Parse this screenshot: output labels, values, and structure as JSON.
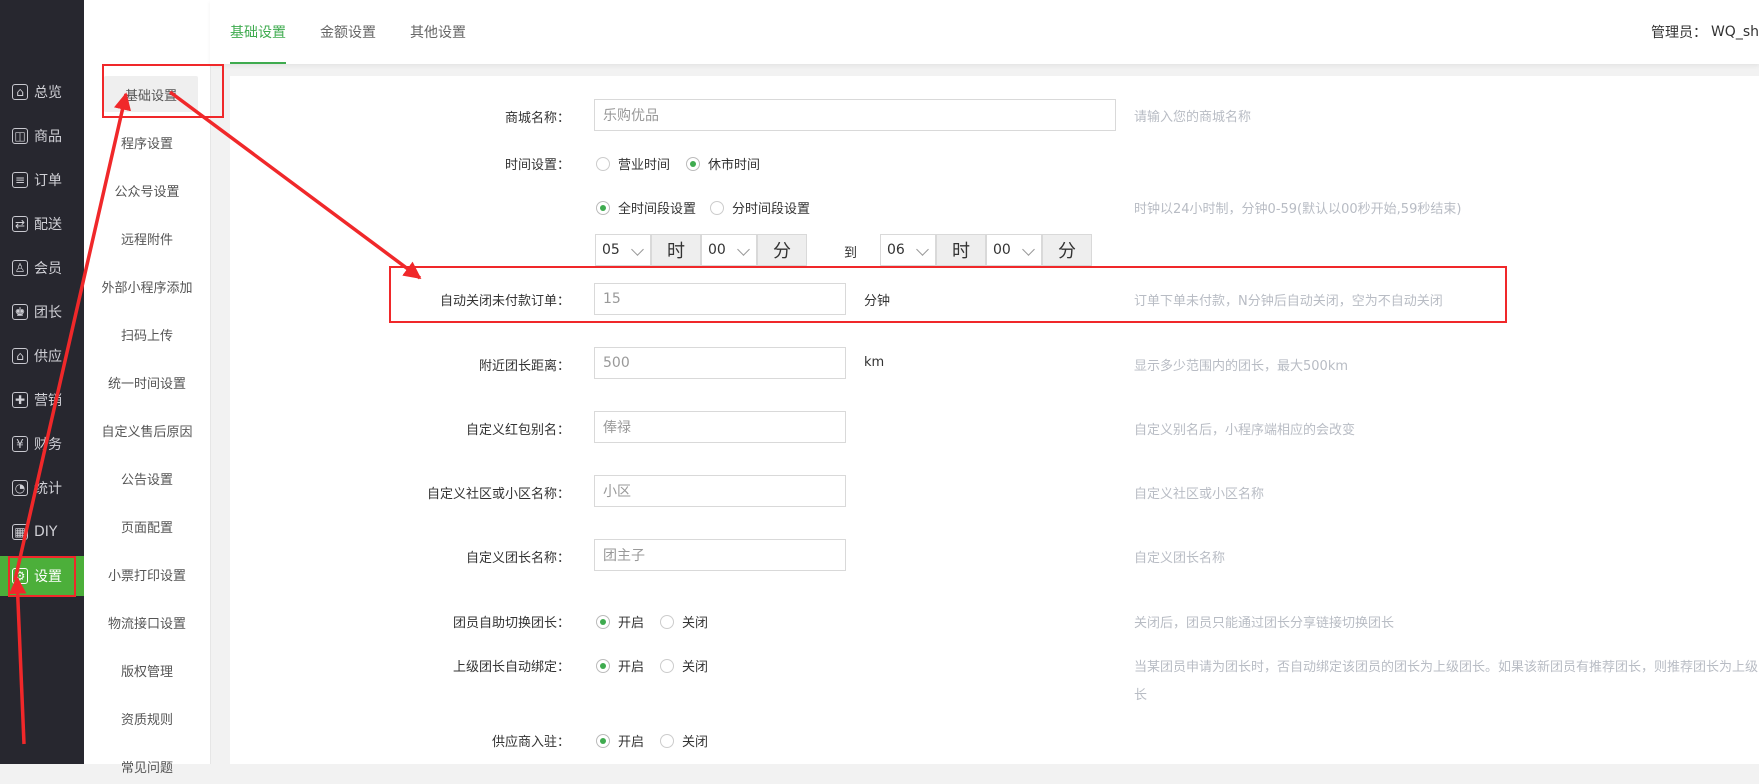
{
  "leftbar": {
    "items": [
      {
        "label": "总览",
        "icon": "home-icon",
        "glyph": "⌂"
      },
      {
        "label": "商品",
        "icon": "goods-icon",
        "glyph": "◫"
      },
      {
        "label": "订单",
        "icon": "order-icon",
        "glyph": "≡"
      },
      {
        "label": "配送",
        "icon": "delivery-icon",
        "glyph": "⇄"
      },
      {
        "label": "会员",
        "icon": "member-icon",
        "glyph": "♙"
      },
      {
        "label": "团长",
        "icon": "leader-icon",
        "glyph": "♚"
      },
      {
        "label": "供应",
        "icon": "supply-icon",
        "glyph": "⌂"
      },
      {
        "label": "营销",
        "icon": "gift-icon",
        "glyph": "✚"
      },
      {
        "label": "财务",
        "icon": "finance-icon",
        "glyph": "¥"
      },
      {
        "label": "统计",
        "icon": "stats-icon",
        "glyph": "◔"
      },
      {
        "label": "DIY",
        "icon": "diy-icon",
        "glyph": "▦"
      },
      {
        "label": "设置",
        "icon": "settings-icon",
        "glyph": "⚙"
      }
    ]
  },
  "subnav": {
    "items": [
      "基础设置",
      "程序设置",
      "公众号设置",
      "远程附件",
      "外部小程序添加",
      "扫码上传",
      "统一时间设置",
      "自定义售后原因",
      "公告设置",
      "页面配置",
      "小票打印设置",
      "物流接口设置",
      "版权管理",
      "资质规则",
      "常见问题"
    ]
  },
  "topbar": {
    "tabs": [
      "基础设置",
      "金额设置",
      "其他设置"
    ],
    "admin_label": "管理员：",
    "admin_name": "WQ_sh"
  },
  "form": {
    "shop_name": {
      "label": "商城名称：",
      "value": "乐购优品",
      "hint": "请输入您的商城名称"
    },
    "time_setting": {
      "label": "时间设置：",
      "opt1": "营业时间",
      "opt2": "休市时间",
      "opt3": "全时间段设置",
      "opt4": "分时间段设置",
      "hint": "时钟以24小时制，分钟0-59(默认以00秒开始,59秒结束)"
    },
    "time_range": {
      "start_h": "05",
      "hour_unit": "时",
      "start_m": "00",
      "minute_unit": "分",
      "to": "到",
      "end_h": "06",
      "end_m": "00"
    },
    "auto_close": {
      "label": "自动关闭未付款订单：",
      "value": "15",
      "unit": "分钟",
      "hint": "订单下单未付款，N分钟后自动关闭，空为不自动关闭"
    },
    "nearby_distance": {
      "label": "附近团长距离：",
      "value": "500",
      "unit": "km",
      "hint": "显示多少范围内的团长，最大500km"
    },
    "redpack_alias": {
      "label": "自定义红包别名：",
      "value": "俸禄",
      "hint": "自定义别名后，小程序端相应的会改变"
    },
    "community_name": {
      "label": "自定义社区或小区名称：",
      "value": "小区",
      "hint": "自定义社区或小区名称"
    },
    "leader_name": {
      "label": "自定义团长名称：",
      "value": "团主子",
      "hint": "自定义团长名称"
    },
    "member_switch": {
      "label": "团员自助切换团长：",
      "on": "开启",
      "off": "关闭",
      "hint": "关闭后，团员只能通过团长分享链接切换团长"
    },
    "auto_bind": {
      "label": "上级团长自动绑定：",
      "on": "开启",
      "off": "关闭",
      "hint_line1": "当某团员申请为团长时，否自动绑定该团员的团长为上级团长。如果该新团员有推荐团长，则推荐团长为上级",
      "hint_line2": "长"
    },
    "supplier": {
      "label": "供应商入驻：",
      "on": "开启",
      "off": "关闭"
    }
  },
  "colors": {
    "accent": "#3fab4f",
    "annotation": "#f0282a",
    "sidebar_bg": "#27272f"
  }
}
